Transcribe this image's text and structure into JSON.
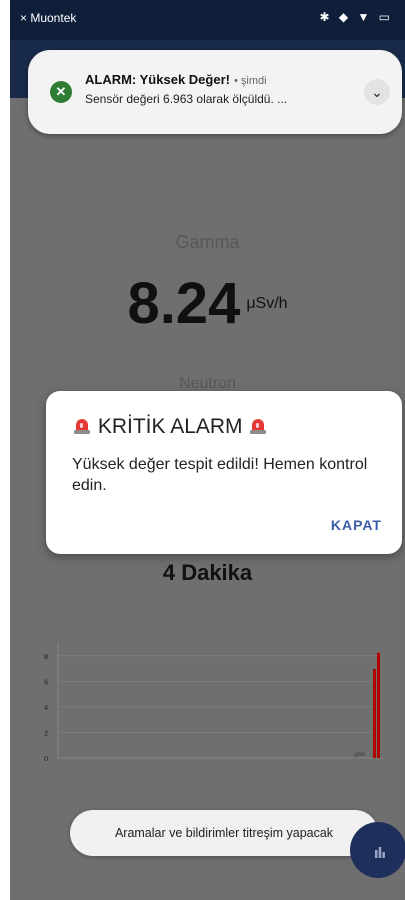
{
  "status_bar": {
    "left": "× Muontek",
    "right": "✱ ◆ ▼ ▭"
  },
  "notification": {
    "title": "ALARM: Yüksek Değer!",
    "time": "• şimdi",
    "text": "Sensör değeri 6.963 olarak ölçüldü. ...",
    "icon": "close-circle-icon",
    "icon_glyph": "✕",
    "expand_glyph": "⌄"
  },
  "main": {
    "gamma_label": "Gamma",
    "gamma_value": "8.24",
    "gamma_unit": "μSv/h",
    "neutron_label": "Neutron",
    "duration": "4 Dakika"
  },
  "dialog": {
    "title": "KRİTİK ALARM",
    "body": "Yüksek değer tespit edildi! Hemen kontrol edin.",
    "button": "KAPAT",
    "icon": "siren-icon"
  },
  "chart_data": {
    "type": "bar",
    "y_ticks": [
      "0",
      "2",
      "4",
      "6",
      "8"
    ],
    "ylim": [
      0,
      9
    ],
    "values": [
      6.963,
      8.24
    ],
    "x_label_text": "µSv",
    "colors": {
      "bar": "#b00000",
      "grid": "#858585"
    }
  },
  "toast": {
    "text": "Aramalar ve bildirimler titreşim yapacak"
  },
  "colors": {
    "status_bar": "#0f1f3a",
    "dim_background": "#6f6f6f",
    "accent": "#3b5ca8",
    "alarm_red": "#d32f2f"
  }
}
